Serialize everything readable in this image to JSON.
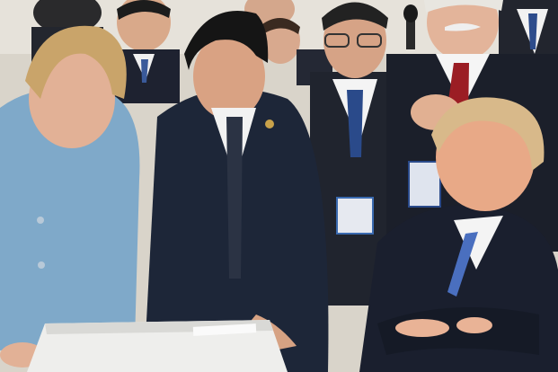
{
  "scene": {
    "kind": "photograph",
    "people": [
      {
        "role": "woman-leaning-on-table",
        "jacket_color": "#7fa9c9",
        "hair_color": "#c9a46a"
      },
      {
        "role": "man-center-leaning",
        "suit_color": "#1d2638",
        "hair_color": "#1a1a1a"
      },
      {
        "role": "man-seated-arms-crossed",
        "suit_color": "#1a1f2e",
        "hair_color": "#d8b98a"
      },
      {
        "role": "man-with-mustache",
        "suit_color": "#1b1f2a",
        "hair_color": "#e8e6e0",
        "tie_color": "#9b1d24"
      },
      {
        "role": "man-with-glasses",
        "suit_color": "#20242e",
        "tie_color": "#2a4a8a"
      },
      {
        "role": "background-group"
      }
    ],
    "objects": [
      "table-with-white-cloth",
      "papers-on-table",
      "lanyard-badges",
      "microphone"
    ],
    "colors": {
      "background": "#dcd8cf",
      "table_cloth": "#eeeeec",
      "skin": "#e8b89a"
    }
  }
}
